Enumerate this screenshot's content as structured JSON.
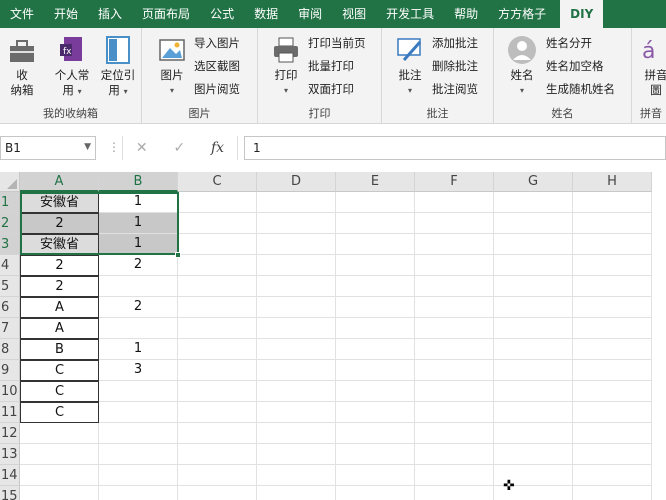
{
  "tabs": [
    "文件",
    "开始",
    "插入",
    "页面布局",
    "公式",
    "数据",
    "审阅",
    "视图",
    "开发工具",
    "帮助",
    "方方格子",
    "DIY"
  ],
  "active_tab_index": 11,
  "ribbon": {
    "groups": {
      "collect": {
        "label": "我的收纳箱",
        "btn1": "收\n纳箱",
        "btn2_line1": "个人常",
        "btn2_line2": "用",
        "btn3_line1": "定位引",
        "btn3_line2": "用"
      },
      "picture": {
        "label": "图片",
        "big": "图片",
        "items": [
          "导入图片",
          "选区截图",
          "图片阅览"
        ]
      },
      "print": {
        "label": "打印",
        "big": "打印",
        "items": [
          "打印当前页",
          "批量打印",
          "双面打印"
        ]
      },
      "comment": {
        "label": "批注",
        "big": "批注",
        "items": [
          "添加批注",
          "删除批注",
          "批注阅览"
        ]
      },
      "name": {
        "label": "姓名",
        "big": "姓名",
        "items": [
          "姓名分开",
          "姓名加空格",
          "生成随机姓名"
        ]
      },
      "pinyin": {
        "label": "拼音",
        "big_line1": "拼音",
        "big_line2": "圖"
      }
    }
  },
  "formula_bar": {
    "name_box": "B1",
    "value": "1",
    "fx": "fx"
  },
  "columns": [
    "A",
    "B",
    "C",
    "D",
    "E",
    "F",
    "G",
    "H"
  ],
  "rows": [
    "1",
    "2",
    "3",
    "4",
    "5",
    "6",
    "7",
    "8",
    "9",
    "10",
    "11",
    "12",
    "13",
    "14",
    "15"
  ],
  "column_a": [
    "安徽省",
    "2",
    "安徽省",
    "2",
    "2",
    "A",
    "A",
    "B",
    "C",
    "C",
    "C"
  ],
  "column_b": [
    "1",
    "1",
    "1",
    "2",
    "",
    "2",
    "",
    "1",
    "3",
    "",
    ""
  ],
  "colors": {
    "accent": "#217346",
    "shade": "#c8c8c8"
  }
}
